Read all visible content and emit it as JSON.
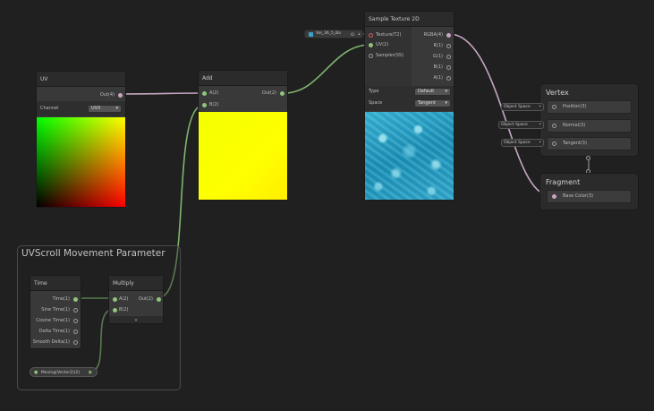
{
  "group": {
    "title": "UVScroll Movement Parameter"
  },
  "uv_node": {
    "title": "UV",
    "out": "Out(4)",
    "channel_label": "Channel",
    "channel_value": "UV0"
  },
  "add_node": {
    "title": "Add",
    "in_a": "A(2)",
    "in_b": "B(2)",
    "out": "Out(2)"
  },
  "sample_node": {
    "title": "Sample Texture 2D",
    "in_texture": "Texture(T2)",
    "in_uv": "UV(2)",
    "in_sampler": "Sampler(SS)",
    "out_rgba": "RGBA(4)",
    "out_r": "R(1)",
    "out_g": "G(1)",
    "out_b": "B(1)",
    "out_a": "A(1)",
    "type_label": "Type",
    "type_value": "Default",
    "space_label": "Space",
    "space_value": "Tangent"
  },
  "texture_field": {
    "value": "Vol_36_5_Ba"
  },
  "time_node": {
    "title": "Time",
    "outputs": [
      "Time(1)",
      "Sine Time(1)",
      "Cosine Time(1)",
      "Delta Time(1)",
      "Smooth Delta(1)"
    ]
  },
  "multiply_node": {
    "title": "Multiply",
    "in_a": "A(2)",
    "in_b": "B(2)",
    "out": "Out(2)"
  },
  "moving_property": {
    "label": "Moving(Vector2)(2)"
  },
  "vertex": {
    "title": "Vertex",
    "blocks": [
      {
        "label": "Position(3)",
        "space": "Object Space"
      },
      {
        "label": "Normal(3)",
        "space": "Object Space"
      },
      {
        "label": "Tangent(3)",
        "space": "Object Space"
      }
    ]
  },
  "fragment": {
    "title": "Fragment",
    "blocks": [
      {
        "label": "Base Color(3)"
      }
    ]
  },
  "colors": {
    "wire_green": "#7fb56e",
    "wire_pink": "#c7a7c3",
    "background": "#202020"
  }
}
